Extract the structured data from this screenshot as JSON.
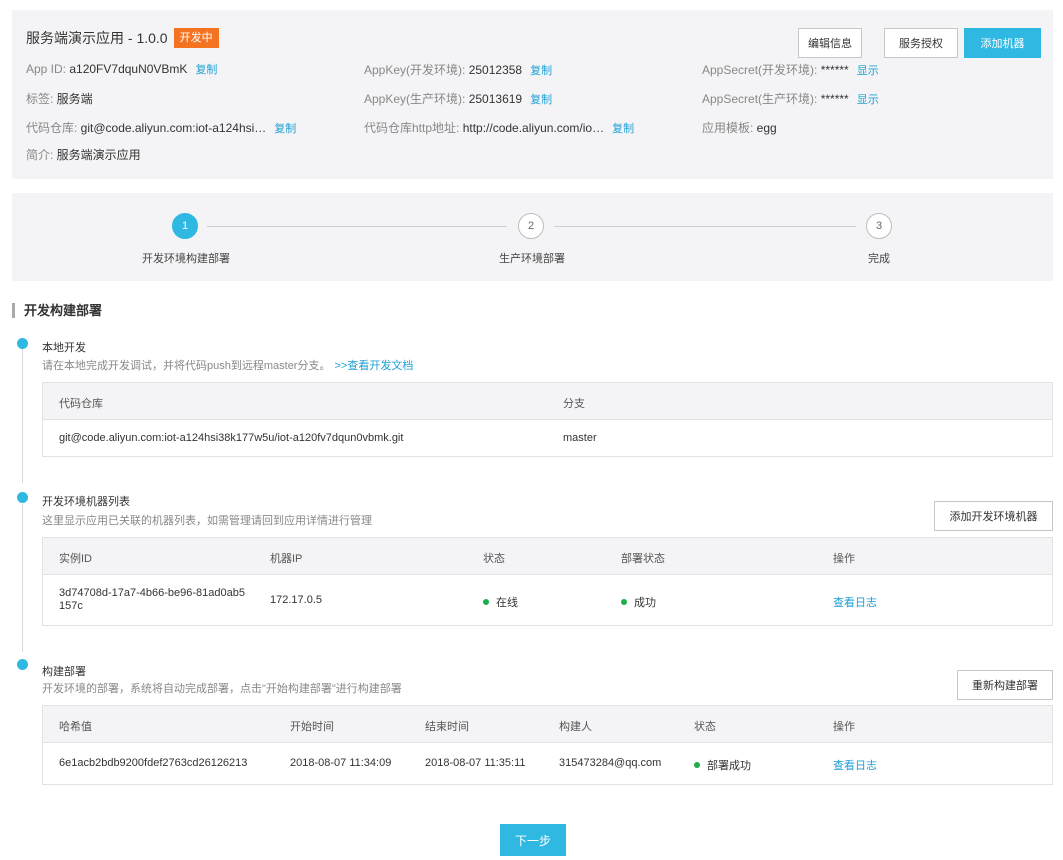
{
  "header": {
    "app_name": "服务端演示应用 - 1.0.0",
    "status_badge": "开发中",
    "btn_edit": "编辑信息",
    "btn_auth": "服务授权",
    "btn_add_machine": "添加机器",
    "copy_label": "复制",
    "show_label": "显示",
    "app_id_label": "App ID: ",
    "app_id": "a120FV7dquN0VBmK",
    "appkey_dev_label": "AppKey(开发环境): ",
    "appkey_dev": "25012358",
    "appsecret_dev_label": "AppSecret(开发环境): ",
    "appsecret_dev": "******",
    "tag_label": "标签: ",
    "tag": "服务端",
    "appkey_prod_label": "AppKey(生产环境): ",
    "appkey_prod": "25013619",
    "appsecret_prod_label": "AppSecret(生产环境): ",
    "appsecret_prod": "******",
    "repo_label": "代码仓库: ",
    "repo": "git@code.aliyun.com:iot-a124hsi…",
    "repo_http_label": "代码仓库http地址: ",
    "repo_http": "http://code.aliyun.com/io…",
    "template_label": "应用模板: ",
    "template": "egg",
    "intro_label": "简介: ",
    "intro": "服务端演示应用"
  },
  "steps": [
    {
      "num": "1",
      "label": "开发环境构建部署",
      "active": true
    },
    {
      "num": "2",
      "label": "生产环境部署",
      "active": false
    },
    {
      "num": "3",
      "label": "完成",
      "active": false
    }
  ],
  "section_title": "开发构建部署",
  "local_dev": {
    "title": "本地开发",
    "desc": "请在本地完成开发调试，并将代码push到远程master分支。",
    "doc_link": ">>查看开发文档",
    "columns": [
      "代码仓库",
      "分支"
    ],
    "row": [
      "git@code.aliyun.com:iot-a124hsi38k177w5u/iot-a120fv7dqun0vbmk.git",
      "master"
    ]
  },
  "machines": {
    "title": "开发环境机器列表",
    "desc": "这里显示应用已关联的机器列表，如需管理请回到应用详情进行管理",
    "add_button": "添加开发环境机器",
    "columns": [
      "实例ID",
      "机器IP",
      "状态",
      "部署状态",
      "操作"
    ],
    "row": {
      "instance_id": "3d74708d-17a7-4b66-be96-81ad0ab5157c",
      "ip": "172.17.0.5",
      "status": "在线",
      "deploy_status": "成功",
      "action": "查看日志"
    }
  },
  "build": {
    "title": "构建部署",
    "desc": "开发环境的部署，系统将自动完成部署，点击\"开始构建部署\"进行构建部署",
    "rebuild_button": "重新构建部署",
    "columns": [
      "哈希值",
      "开始时间",
      "结束时间",
      "构建人",
      "状态",
      "操作"
    ],
    "row": {
      "hash": "6e1acb2bdb9200fdef2763cd26126213",
      "start": "2018-08-07 11:34:09",
      "end": "2018-08-07 11:35:11",
      "builder": "315473284@qq.com",
      "status": "部署成功",
      "action": "查看日志"
    }
  },
  "next_button": "下一步",
  "colors": {
    "accent": "#2fb8e2",
    "badge": "#f37321",
    "success": "#1aaf4b",
    "link": "#1e9fd4"
  }
}
